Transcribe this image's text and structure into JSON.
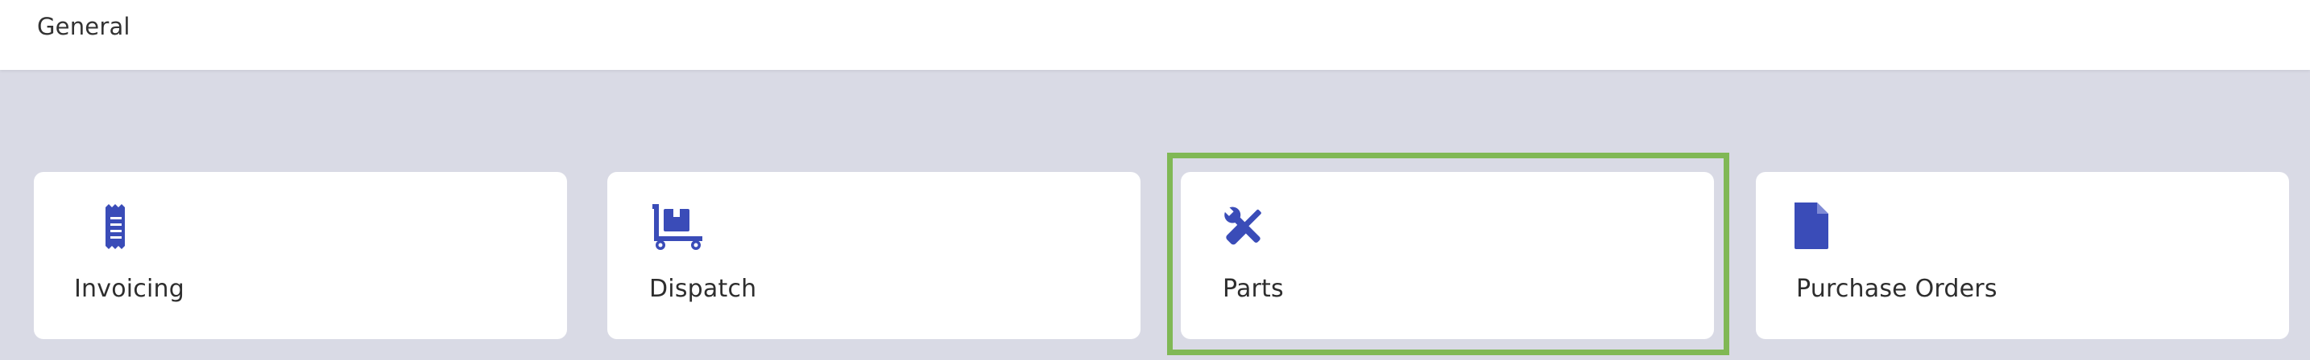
{
  "header": {
    "title": "General"
  },
  "colors": {
    "accent": "#3a4cb8",
    "background": "#d9dae5",
    "card": "#ffffff",
    "highlight": "#80b855"
  },
  "cards": [
    {
      "label": "Invoicing",
      "icon": "receipt-icon"
    },
    {
      "label": "Dispatch",
      "icon": "dolly-cart-icon"
    },
    {
      "label": "Parts",
      "icon": "tools-icon"
    },
    {
      "label": "Purchase Orders",
      "icon": "document-icon"
    }
  ]
}
